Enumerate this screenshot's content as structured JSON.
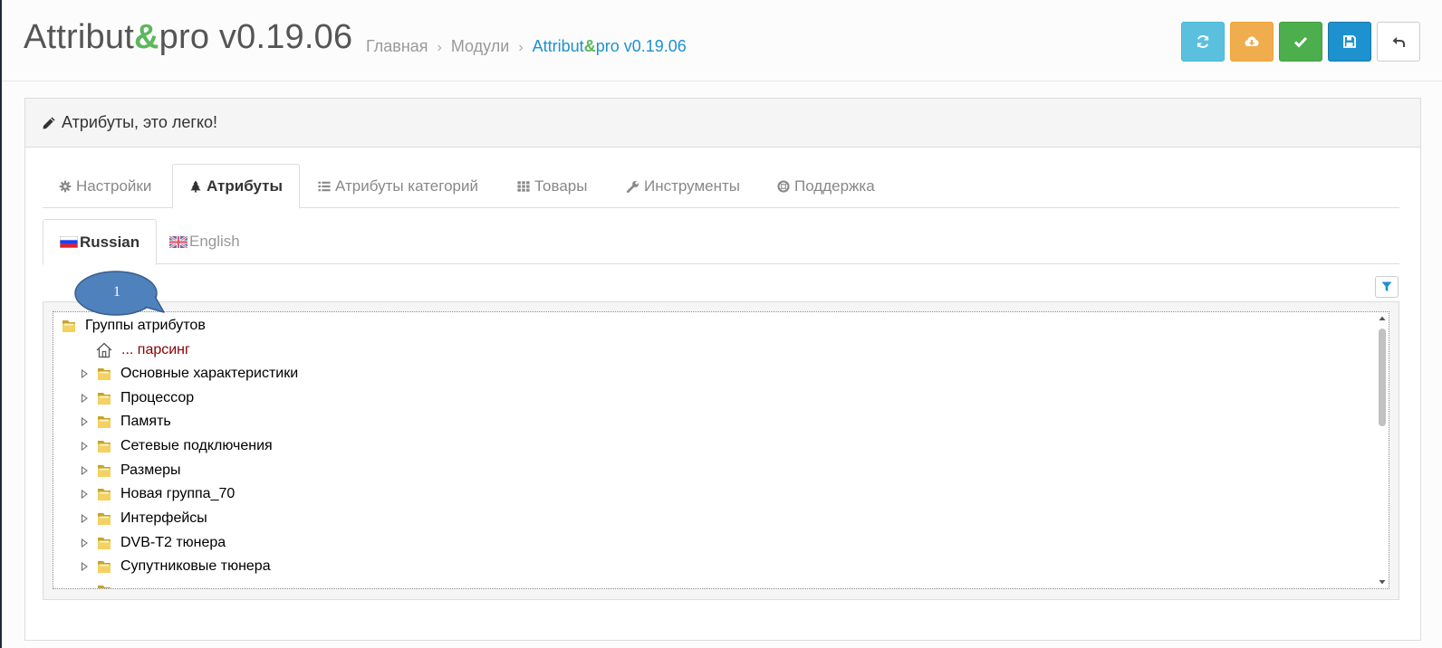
{
  "header": {
    "title_pre": "Attribut",
    "title_amp": "&",
    "title_post": "pro v0.19.06",
    "breadcrumb": {
      "home": "Главная",
      "modules": "Модули",
      "current_pre": "Attribut",
      "current_amp": "&",
      "current_post": "pro v0.19.06"
    },
    "buttons": [
      {
        "icon": "refresh-icon",
        "color": "#5bc0de"
      },
      {
        "icon": "cloud-download-icon",
        "color": "#f0ad4e"
      },
      {
        "icon": "check-icon",
        "color": "#4cae4c"
      },
      {
        "icon": "save-icon",
        "color": "#1e91cf"
      },
      {
        "icon": "reply-icon",
        "color": "#ffffff"
      }
    ]
  },
  "panel": {
    "heading": "Атрибуты, это легко!",
    "heading_icon": "pencil-icon"
  },
  "tabs": [
    {
      "label": "Настройки",
      "icon": "gear-icon"
    },
    {
      "label": "Атрибуты",
      "icon": "tree-icon",
      "active": true
    },
    {
      "label": "Атрибуты категорий",
      "icon": "list-icon"
    },
    {
      "label": "Товары",
      "icon": "grid-icon"
    },
    {
      "label": "Инструменты",
      "icon": "wrench-icon"
    },
    {
      "label": "Поддержка",
      "icon": "lifebuoy-icon"
    }
  ],
  "lang_tabs": [
    {
      "label": "Russian",
      "active": true
    },
    {
      "label": "English"
    }
  ],
  "tree": {
    "root": "Группы атрибутов",
    "special": "... парсинг",
    "groups": [
      "Основные характеристики",
      "Процессор",
      "Память",
      "Сетевые подключения",
      "Размеры",
      "Новая группа_70",
      "Интерфейсы",
      "DVB-T2 тюнера",
      "Супутниковые тюнера"
    ]
  },
  "callout": {
    "label": "1"
  }
}
